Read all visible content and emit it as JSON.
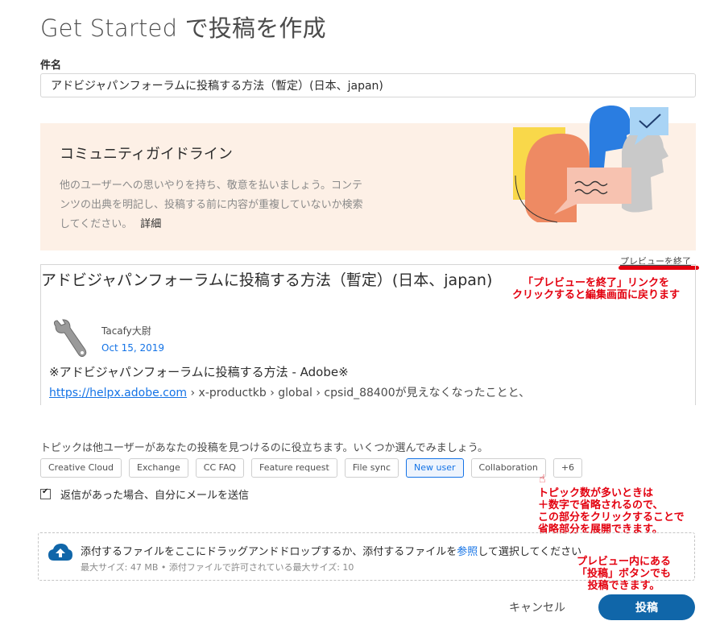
{
  "page": {
    "title": "Get Started で投稿を作成"
  },
  "subject": {
    "label": "件名",
    "value": "アドビジャパンフォーラムに投稿する方法（暫定）(日本、japan)"
  },
  "guidelines": {
    "title": "コミュニティガイドライン",
    "line1": "他のユーザーへの思いやりを持ち、敬意を払いましょう。コンテ",
    "line2": "ンツの出典を明記し、投稿する前に内容が重複していないか検索",
    "line3": "してください。",
    "detail_label": "詳細"
  },
  "preview": {
    "exit_label": "プレビューを終了",
    "title": "アドビジャパンフォーラムに投稿する方法（暫定）(日本、japan)",
    "author": "Tacafy大尉",
    "date": "Oct 15, 2019",
    "body_line1": "※アドビジャパンフォーラムに投稿する方法 - Adobe※",
    "link_text": "https://helpx.adobe.com",
    "body_line2_rest": " › x-productkb › global › cpsid_88400が見えなくなったことと、"
  },
  "annotations": {
    "preview_line1": "「プレビューを終了」リンクを",
    "preview_line2": "クリックすると編集画面に戻ります",
    "topics_line1": "トピック数が多いときは",
    "topics_line2": "＋数字で省略されるので、",
    "topics_line3": "この部分をクリックすることで",
    "topics_line4": "省略部分を展開できます。",
    "post_line1": "プレビュー内にある",
    "post_line2": "「投稿」ボタンでも",
    "post_line3": "投稿できます。"
  },
  "topics": {
    "hint": "トピックは他ユーザーがあなたの投稿を見つけるのに役立ちます。いくつか選んでみましょう。",
    "tags": [
      {
        "label": "Creative Cloud"
      },
      {
        "label": "Exchange"
      },
      {
        "label": "CC FAQ"
      },
      {
        "label": "Feature request"
      },
      {
        "label": "File sync"
      },
      {
        "label": "New user"
      },
      {
        "label": "Collaboration"
      },
      {
        "label": "+6"
      }
    ],
    "selected": "New user"
  },
  "email_option": {
    "label": "返信があった場合、自分にメールを送信",
    "checked": true
  },
  "attachments": {
    "prompt_before": "添付するファイルをここにドラッグアンドドロップするか、添付するファイルを",
    "prompt_link": "参照",
    "prompt_after": "して選択してください",
    "limits": "最大サイズ: 47 MB • 添付ファイルで許可されている最大サイズ: 10"
  },
  "actions": {
    "cancel": "キャンセル",
    "submit": "投稿"
  },
  "colors": {
    "accent": "#1473e6",
    "submit_bg": "#1066a9",
    "annotation": "#e3000f",
    "guidelines_bg": "#fdf0e6"
  }
}
